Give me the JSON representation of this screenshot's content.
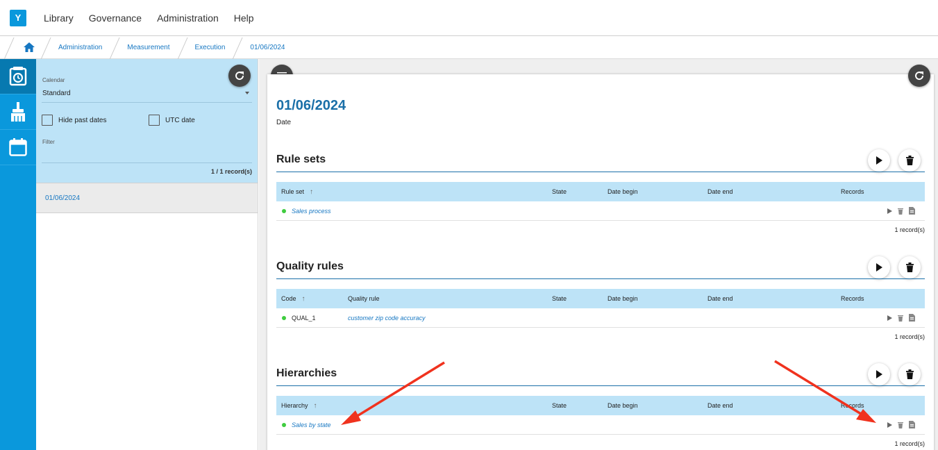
{
  "app": {
    "logo": "Y",
    "menu": [
      "Library",
      "Governance",
      "Administration",
      "Help"
    ]
  },
  "breadcrumb": [
    "Administration",
    "Measurement",
    "Execution",
    "01/06/2024"
  ],
  "rail": [
    "measurement-icon",
    "cleaning-brush-icon",
    "calendar-icon"
  ],
  "left_panel": {
    "calendar_label": "Calendar",
    "calendar_value": "Standard",
    "hide_past_dates_label": "Hide past dates",
    "utc_date_label": "UTC date",
    "filter_label": "Filter",
    "record_count": "1 / 1 record(s)",
    "items": [
      "01/06/2024"
    ]
  },
  "detail": {
    "title": "01/06/2024",
    "subtitle": "Date"
  },
  "sections": [
    {
      "title": "Rule sets",
      "columns": [
        "Rule set",
        "State",
        "Date begin",
        "Date end",
        "Records"
      ],
      "row": {
        "name": "Sales process"
      },
      "count": "1 record(s)"
    },
    {
      "title": "Quality rules",
      "columns": [
        "Code",
        "Quality rule",
        "State",
        "Date begin",
        "Date end",
        "Records"
      ],
      "row": {
        "code": "QUAL_1",
        "name": "customer zip code accuracy"
      },
      "count": "1 record(s)"
    },
    {
      "title": "Hierarchies",
      "columns": [
        "Hierarchy",
        "State",
        "Date begin",
        "Date end",
        "Records"
      ],
      "row": {
        "name": "Sales by state"
      },
      "count": "1 record(s)"
    }
  ],
  "colors": {
    "brand_blue": "#0a98dc",
    "panel_light_blue": "#bde3f7",
    "title_blue": "#1a6fa8",
    "status_green": "#3fcc3f",
    "annotation_red": "#f0321e"
  }
}
